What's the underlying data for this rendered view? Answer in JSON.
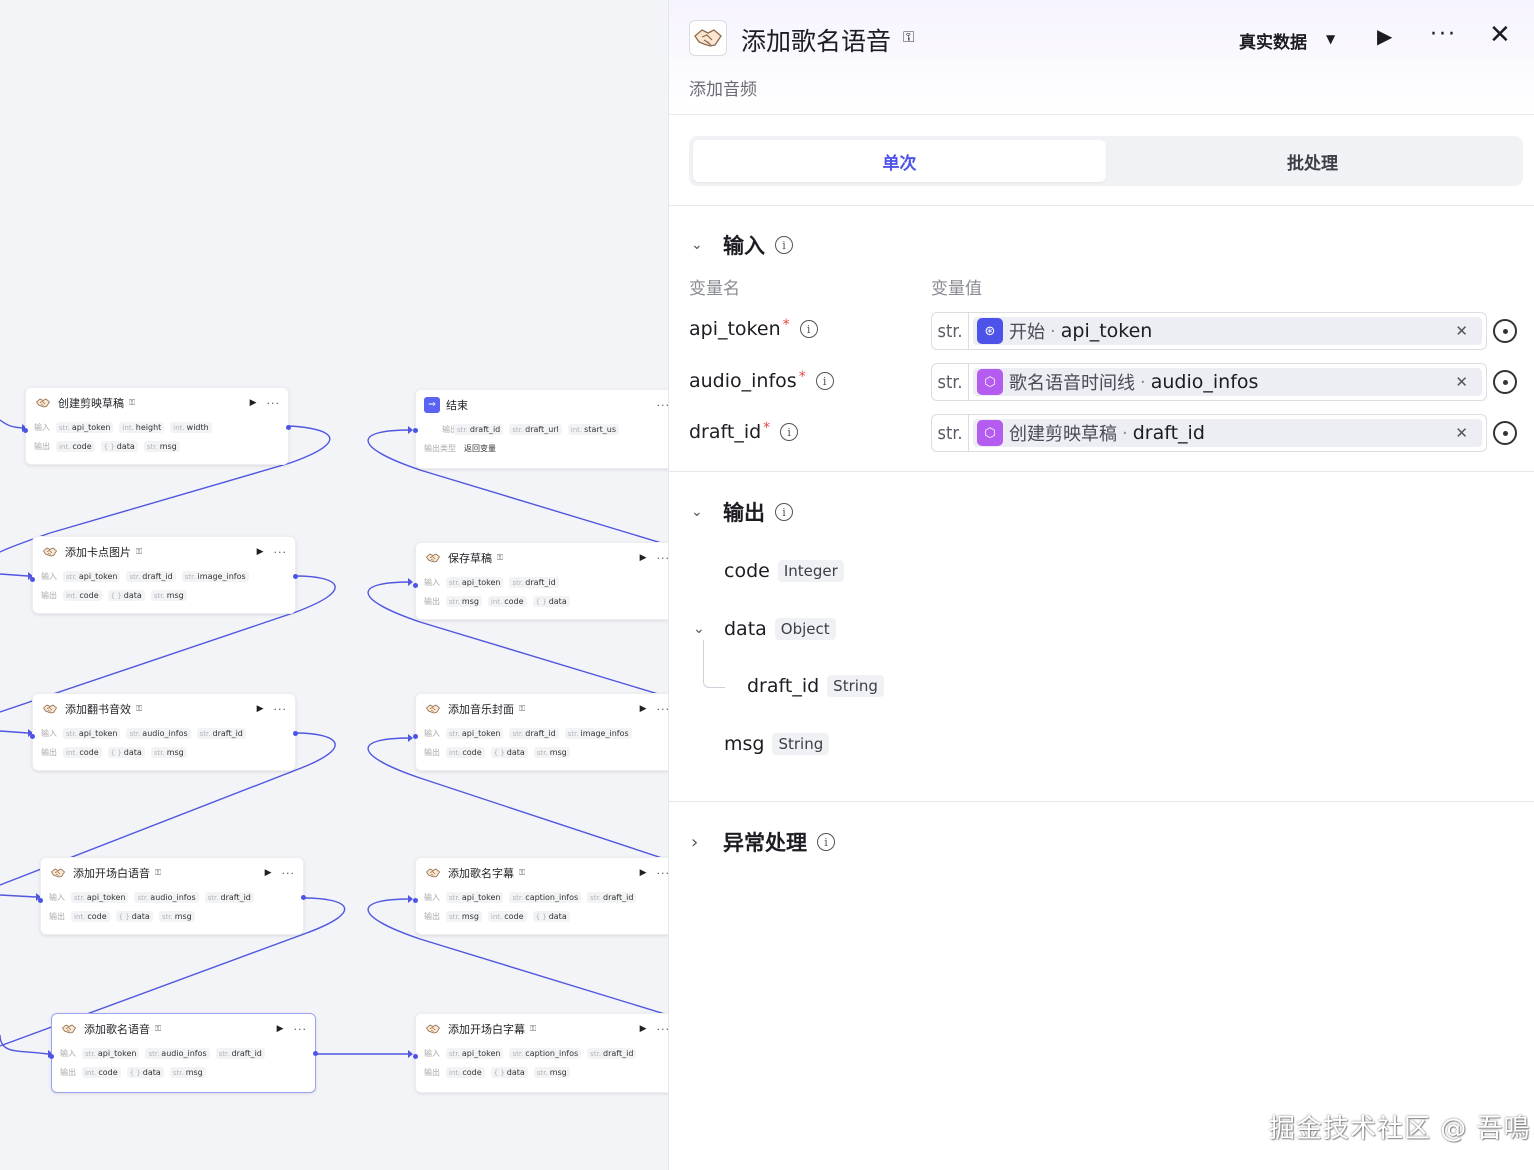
{
  "canvas": {
    "label_in": "输入",
    "label_out": "输出",
    "nodes": [
      {
        "title": "创建剪映草稿",
        "inputs": [
          [
            "str.",
            "api_token"
          ],
          [
            "int.",
            "height"
          ],
          [
            "int.",
            "width"
          ]
        ],
        "outputs": [
          [
            "int.",
            "code"
          ],
          [
            "{ }",
            "data"
          ],
          [
            "str.",
            "msg"
          ]
        ]
      },
      {
        "title": "添加卡点图片",
        "inputs": [
          [
            "str.",
            "api_token"
          ],
          [
            "str.",
            "draft_id"
          ],
          [
            "str.",
            "image_infos"
          ]
        ],
        "outputs": [
          [
            "int.",
            "code"
          ],
          [
            "{ }",
            "data"
          ],
          [
            "str.",
            "msg"
          ]
        ]
      },
      {
        "title": "添加翻书音效",
        "inputs": [
          [
            "str.",
            "api_token"
          ],
          [
            "str.",
            "audio_infos"
          ],
          [
            "str.",
            "draft_id"
          ]
        ],
        "outputs": [
          [
            "int.",
            "code"
          ],
          [
            "{ }",
            "data"
          ],
          [
            "str.",
            "msg"
          ]
        ]
      },
      {
        "title": "添加开场白语音",
        "inputs": [
          [
            "str.",
            "api_token"
          ],
          [
            "str.",
            "audio_infos"
          ],
          [
            "str.",
            "draft_id"
          ]
        ],
        "outputs": [
          [
            "int.",
            "code"
          ],
          [
            "{ }",
            "data"
          ],
          [
            "str.",
            "msg"
          ]
        ]
      },
      {
        "title": "添加歌名语音",
        "inputs": [
          [
            "str.",
            "api_token"
          ],
          [
            "str.",
            "audio_infos"
          ],
          [
            "str.",
            "draft_id"
          ]
        ],
        "outputs": [
          [
            "int.",
            "code"
          ],
          [
            "{ }",
            "data"
          ],
          [
            "str.",
            "msg"
          ]
        ]
      },
      {
        "title": "结束",
        "output_label": "输出",
        "outputs_line": [
          [
            "str.",
            "draft_id"
          ],
          [
            "str.",
            "draft_url"
          ],
          [
            "int.",
            "start_us"
          ]
        ],
        "type_label": "输出类型",
        "type_value": "返回变量"
      },
      {
        "title": "保存草稿",
        "inputs": [
          [
            "str.",
            "api_token"
          ],
          [
            "str.",
            "draft_id"
          ]
        ],
        "outputs": [
          [
            "str.",
            "msg"
          ],
          [
            "int.",
            "code"
          ],
          [
            "{ }",
            "data"
          ]
        ]
      },
      {
        "title": "添加音乐封面",
        "inputs": [
          [
            "str.",
            "api_token"
          ],
          [
            "str.",
            "draft_id"
          ],
          [
            "str.",
            "image_infos"
          ]
        ],
        "outputs": [
          [
            "int.",
            "code"
          ],
          [
            "{ }",
            "data"
          ],
          [
            "str.",
            "msg"
          ]
        ]
      },
      {
        "title": "添加歌名字幕",
        "inputs": [
          [
            "str.",
            "api_token"
          ],
          [
            "str.",
            "caption_infos"
          ],
          [
            "str.",
            "draft_id"
          ]
        ],
        "outputs": [
          [
            "str.",
            "msg"
          ],
          [
            "int.",
            "code"
          ],
          [
            "{ }",
            "data"
          ]
        ]
      },
      {
        "title": "添加开场白字幕",
        "inputs": [
          [
            "str.",
            "api_token"
          ],
          [
            "str.",
            "caption_infos"
          ],
          [
            "str.",
            "draft_id"
          ]
        ],
        "outputs": [
          [
            "int.",
            "code"
          ],
          [
            "{ }",
            "data"
          ],
          [
            "str.",
            "msg"
          ]
        ]
      }
    ]
  },
  "panel": {
    "title": "添加歌名语音",
    "subtitle": "添加音频",
    "data_mode": "真实数据",
    "tabs": [
      "单次",
      "批处理"
    ],
    "input_section": "输入",
    "col_name": "变量名",
    "col_value": "变量值",
    "params": [
      {
        "name": "api_token",
        "type": "str.",
        "source": "开始",
        "var": "api_token",
        "icon_color": "#4d53e8"
      },
      {
        "name": "audio_infos",
        "type": "str.",
        "source": "歌名语音时间线",
        "var": "audio_infos",
        "icon_color": "#b45cf0"
      },
      {
        "name": "draft_id",
        "type": "str.",
        "source": "创建剪映草稿",
        "var": "draft_id",
        "icon_color": "#b45cf0"
      }
    ],
    "required_mark": "*",
    "output_section": "输出",
    "outputs": {
      "code": {
        "name": "code",
        "type": "Integer"
      },
      "data": {
        "name": "data",
        "type": "Object"
      },
      "draft_id": {
        "name": "draft_id",
        "type": "String"
      },
      "msg": {
        "name": "msg",
        "type": "String"
      }
    },
    "exception_section": "异常处理"
  },
  "watermark": "掘金技术社区 @ 吾鳴",
  "colors": {
    "accent": "#4d53e8",
    "edge": "#5057e0",
    "required": "#e5483f"
  }
}
